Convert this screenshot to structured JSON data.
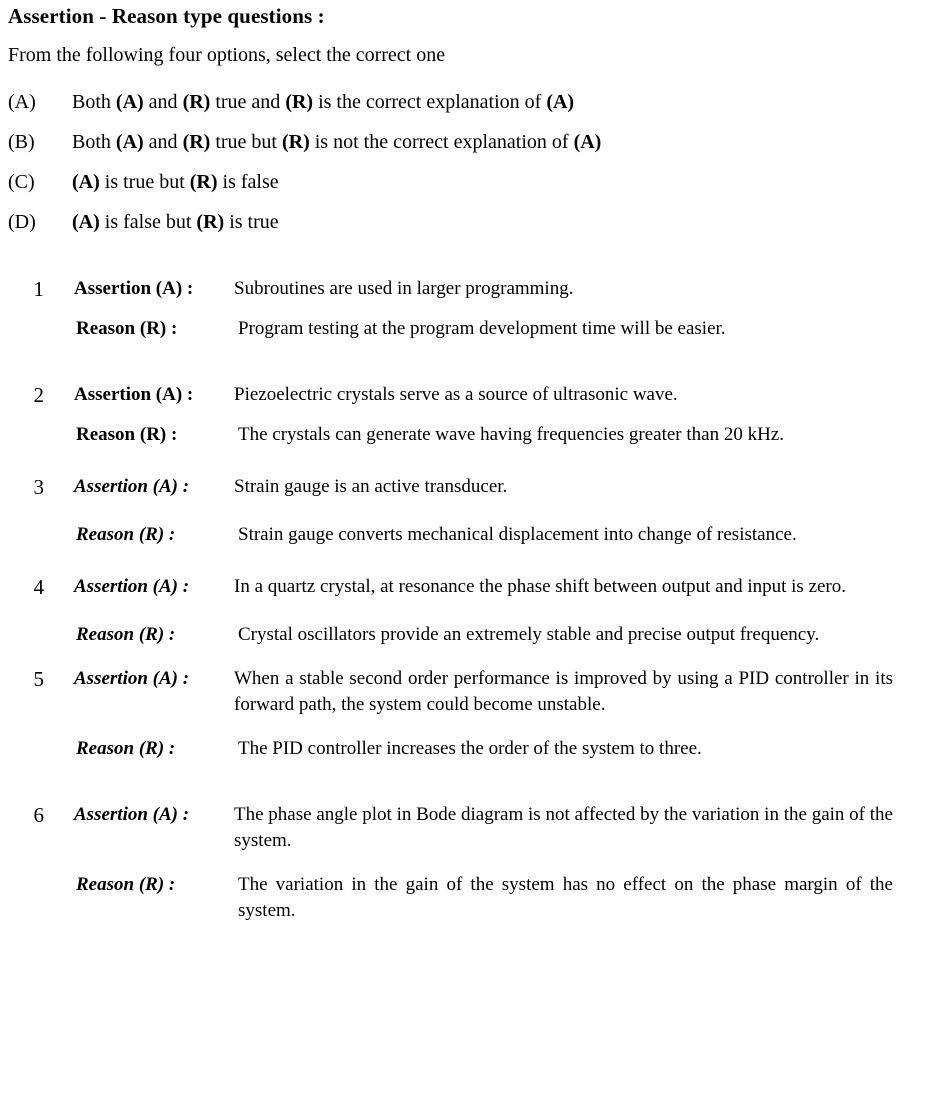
{
  "header": {
    "title": "Assertion - Reason type questions :",
    "subtitle": "From the following four options, select the correct one"
  },
  "options": [
    {
      "marker": "(A)",
      "pre": "Both ",
      "a1": "(A)",
      "mid1": " and ",
      "r1": "(R)",
      "mid2": " true and ",
      "r2": "(R)",
      "mid3": " is the correct explanation of ",
      "a2": "(A)"
    },
    {
      "marker": "(B)",
      "pre": "Both ",
      "a1": "(A)",
      "mid1": " and ",
      "r1": "(R)",
      "mid2": " true but ",
      "r2": "(R)",
      "mid3": " is not the correct explanation of ",
      "a2": "(A)"
    },
    {
      "marker": "(C)",
      "pre": "",
      "a1": "(A)",
      "mid1": " is true but ",
      "r1": "(R)",
      "mid2": " is false",
      "r2": "",
      "mid3": "",
      "a2": ""
    },
    {
      "marker": "(D)",
      "pre": "",
      "a1": "(A)",
      "mid1": " is false but ",
      "r1": "(R)",
      "mid2": " is true",
      "r2": "",
      "mid3": "",
      "a2": ""
    }
  ],
  "labels": {
    "assertion": "Assertion (A) :",
    "reason": "Reason (R) :"
  },
  "questions": [
    {
      "number": "1",
      "style": "upright",
      "assertion": "Subroutines are used in larger programming.",
      "reason": "Program testing at the program development time will be easier."
    },
    {
      "number": "2",
      "style": "upright",
      "assertion": "Piezoelectric crystals serve as a source of ultrasonic wave.",
      "reason": "The crystals can generate wave having frequencies greater than 20 kHz."
    },
    {
      "number": "3",
      "style": "italic",
      "assertion": "Strain gauge is an active transducer.",
      "reason": "Strain gauge converts mechanical displacement into change of resistance."
    },
    {
      "number": "4",
      "style": "italic",
      "assertion": "In a quartz crystal, at resonance the phase shift between output and input is zero.",
      "reason": "Crystal oscillators provide an extremely stable and precise output frequency."
    },
    {
      "number": "5",
      "style": "italic",
      "assertion": "When a stable second order performance is improved by using a PID controller in its forward path, the system could become unstable.",
      "reason": "The PID controller increases the order of the system to three."
    },
    {
      "number": "6",
      "style": "italic",
      "assertion": "The phase angle plot in Bode diagram is not affected by the variation in the gain of the system.",
      "reason": "The variation in the gain of the system has no effect on the phase margin of the system."
    }
  ]
}
